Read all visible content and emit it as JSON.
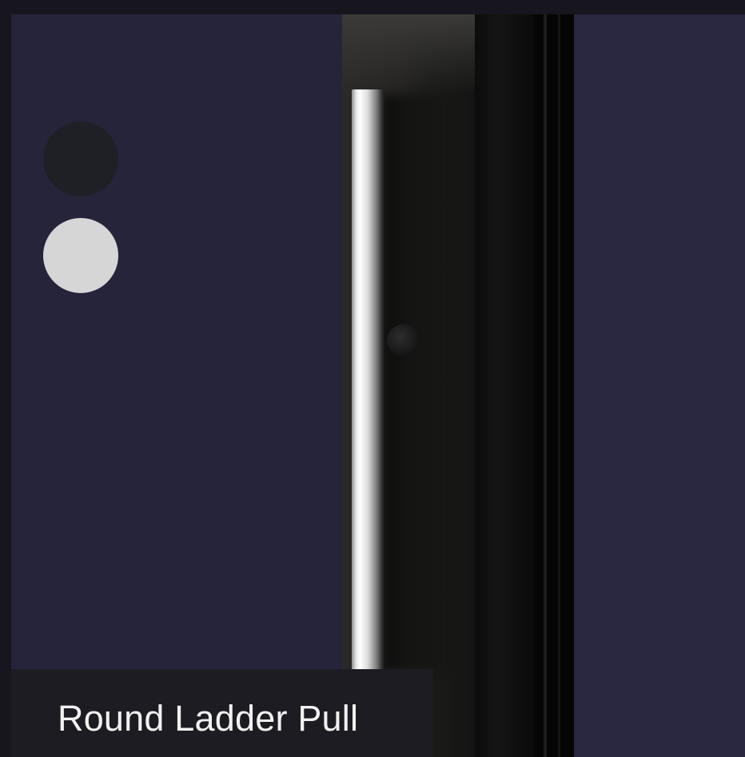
{
  "product": {
    "name": "Round Ladder Pull"
  },
  "finish_options": [
    {
      "name": "matte-black",
      "color": "#1f2026"
    },
    {
      "name": "brushed-silver",
      "color": "#d6d6d6"
    }
  ],
  "colors": {
    "card_background": "#26243a",
    "caption_background": "#1d1c22",
    "page_background": "#17161f"
  }
}
